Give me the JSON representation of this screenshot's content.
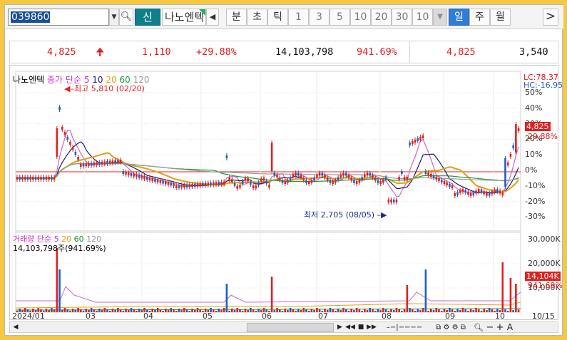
{
  "toolbar": {
    "code": "039860",
    "name": "나노엔텍",
    "new_label": "신",
    "periods": [
      "분",
      "초",
      "틱",
      "1",
      "3",
      "5",
      "10",
      "20",
      "30",
      "10"
    ],
    "selected_period": "일",
    "periods_after": [
      "주",
      "월"
    ]
  },
  "quote": {
    "price": "4,825",
    "change": "1,110",
    "change_pct": "+29.88%",
    "volume": "14,103,798",
    "volume_ratio": "941.69%",
    "current": "4,825",
    "prev_close": "3,540"
  },
  "price_panel": {
    "title": "나노엔텍",
    "ma_label": "종가 단순",
    "ma_periods": [
      "5",
      "10",
      "20",
      "60",
      "120"
    ],
    "high_note": "최고 5,810 (02/20)",
    "low_note": "최저 2,705 (08/05)",
    "lc": "LC:78.37",
    "hc": "HC:-16.95",
    "y_ticks": [
      "50%",
      "40%",
      "30%",
      "20%",
      "10%",
      "0%",
      "-10%",
      "-20%",
      "-30%"
    ],
    "last_price": "4,825",
    "last_pct": "29.88%"
  },
  "volume_panel": {
    "title": "거래량 단순",
    "ma_periods": [
      "5",
      "20",
      "60",
      "120"
    ],
    "info": "14,103,798주(941.69%)",
    "y_ticks": [
      "30,000K",
      "20,000K",
      "10,000K"
    ],
    "last_vol": "14,104K",
    "last_pct": "941.69%"
  },
  "x_axis": [
    "2024/01",
    "03",
    "04",
    "05",
    "06",
    "07",
    "08",
    "09",
    "10",
    "10/15"
  ],
  "colors": {
    "up": "#e0211f",
    "down": "#1d5fc4",
    "ma5": "#cc66cc",
    "ma10": "#1a1a6e",
    "ma20": "#e2a010",
    "ma60": "#1a9a3a",
    "ma120": "#999999"
  },
  "icons": [
    "search-icon",
    "prev-arrow-icon",
    "next-arrow-icon",
    "zoom-in-icon",
    "zoom-out-icon"
  ]
}
